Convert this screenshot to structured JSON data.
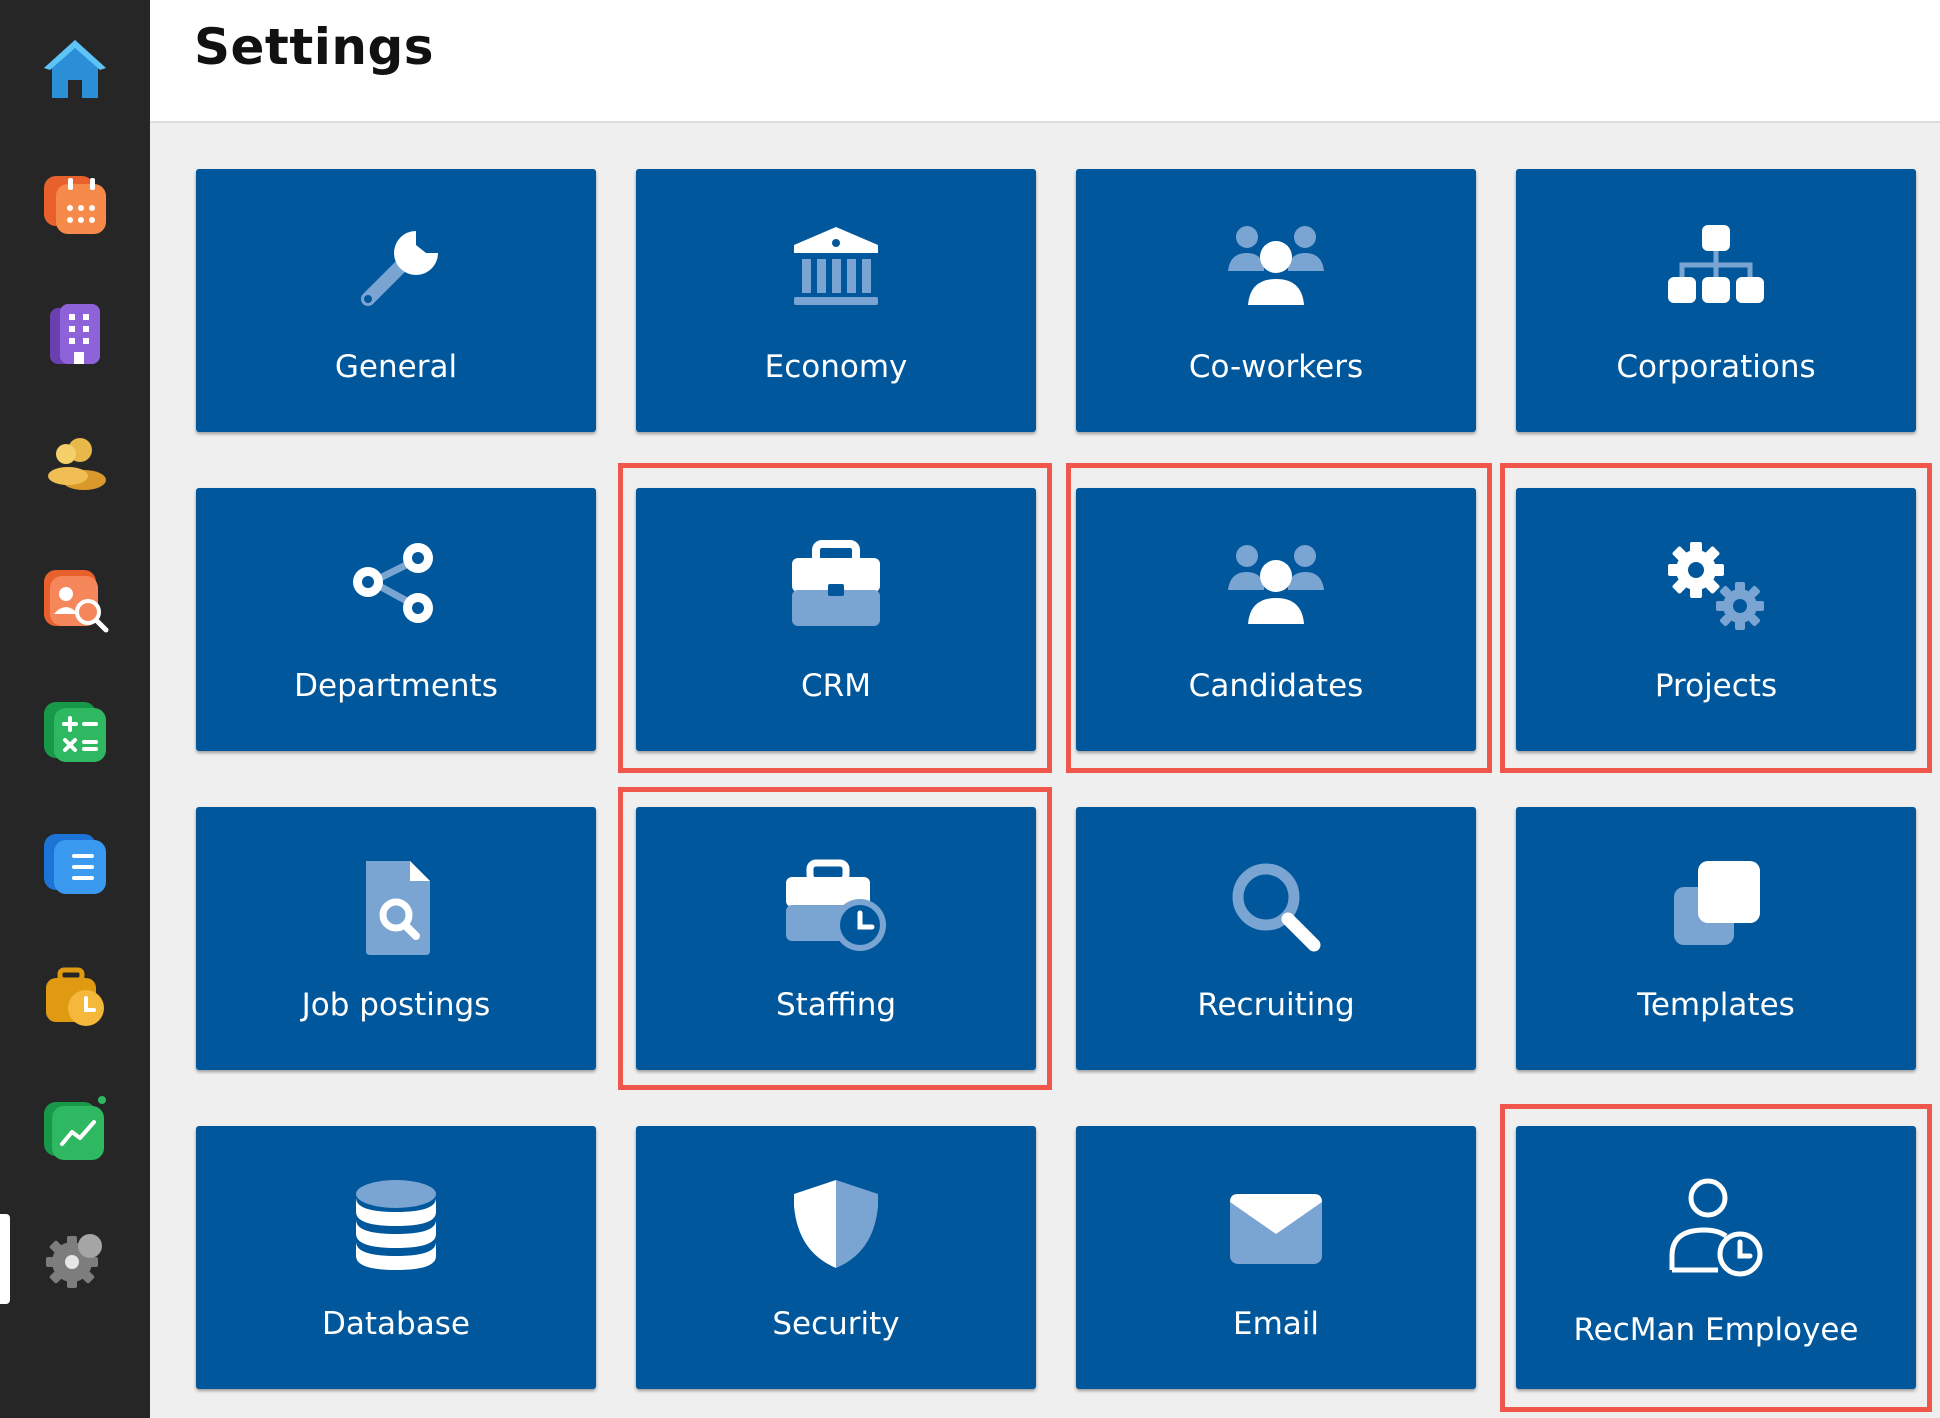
{
  "header": {
    "title": "Settings"
  },
  "sidebar": {
    "items": [
      {
        "name": "home",
        "icon": "home-icon"
      },
      {
        "name": "calendar",
        "icon": "calendar-icon"
      },
      {
        "name": "company",
        "icon": "building-icon"
      },
      {
        "name": "contacts",
        "icon": "people-icon"
      },
      {
        "name": "candidate-search",
        "icon": "person-search-icon"
      },
      {
        "name": "calculations",
        "icon": "calculator-icon"
      },
      {
        "name": "documents",
        "icon": "document-list-icon"
      },
      {
        "name": "staffing",
        "icon": "briefcase-clock-icon"
      },
      {
        "name": "analytics",
        "icon": "chart-icon"
      },
      {
        "name": "settings",
        "icon": "gear-icon",
        "active": true
      }
    ]
  },
  "tiles": [
    {
      "label": "General",
      "icon": "wrench-icon"
    },
    {
      "label": "Economy",
      "icon": "bank-icon"
    },
    {
      "label": "Co-workers",
      "icon": "users-icon"
    },
    {
      "label": "Corporations",
      "icon": "org-chart-icon"
    },
    {
      "label": "Departments",
      "icon": "share-nodes-icon"
    },
    {
      "label": "CRM",
      "icon": "briefcase-icon",
      "highlighted": true
    },
    {
      "label": "Candidates",
      "icon": "users-icon",
      "highlighted": true
    },
    {
      "label": "Projects",
      "icon": "gears-icon",
      "highlighted": true
    },
    {
      "label": "Job postings",
      "icon": "file-search-icon"
    },
    {
      "label": "Staffing",
      "icon": "briefcase-clock-icon",
      "highlighted": true
    },
    {
      "label": "Recruiting",
      "icon": "magnifier-icon"
    },
    {
      "label": "Templates",
      "icon": "clone-icon"
    },
    {
      "label": "Database",
      "icon": "database-icon"
    },
    {
      "label": "Security",
      "icon": "shield-icon"
    },
    {
      "label": "Email",
      "icon": "envelope-icon"
    },
    {
      "label": "RecMan Employee",
      "icon": "user-clock-icon",
      "highlighted": true
    }
  ],
  "colors": {
    "tile_bg": "#01579b",
    "icon_light": "#ffffff",
    "icon_muted": "#7aa4d2",
    "highlight": "#f0564a",
    "sidebar_bg": "#262626"
  }
}
